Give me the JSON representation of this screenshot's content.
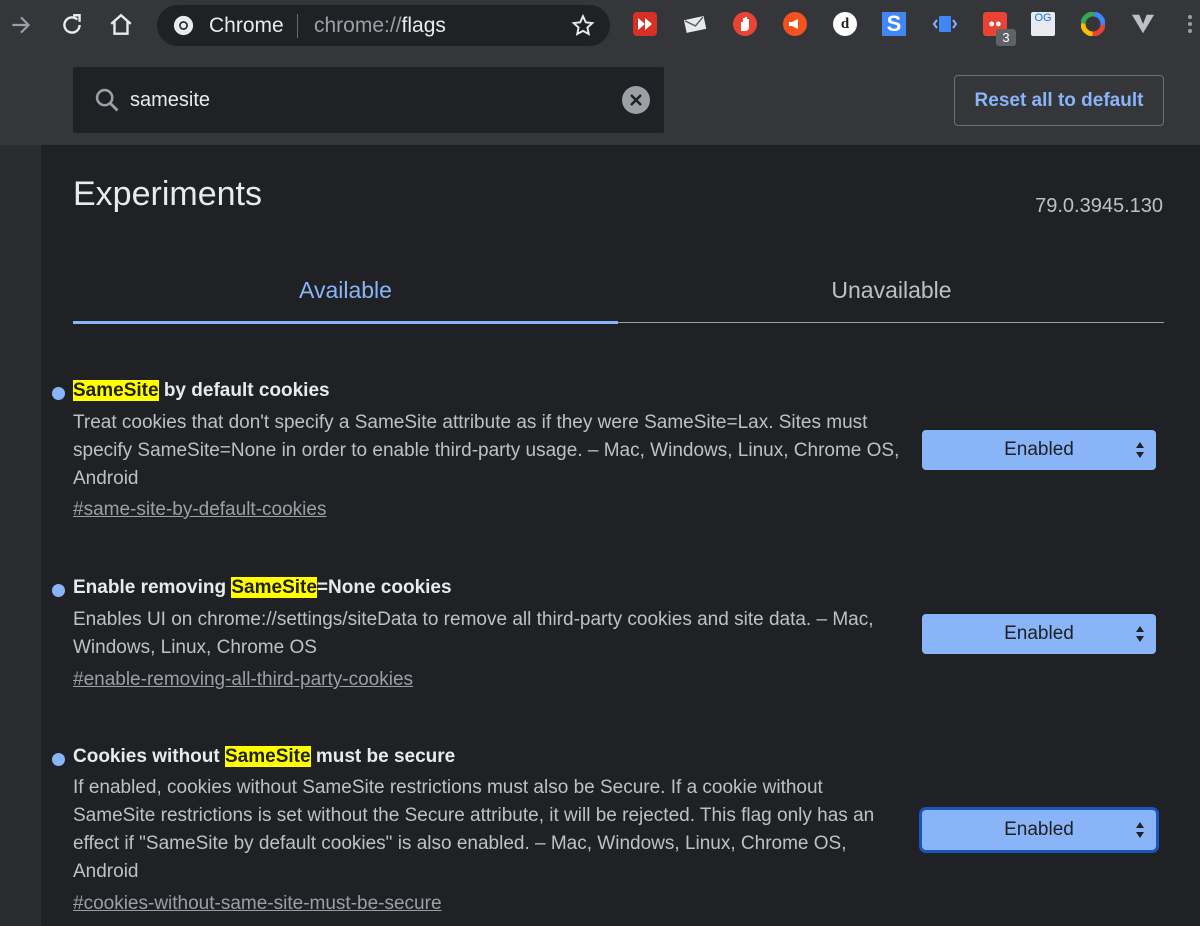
{
  "browser": {
    "site_label": "Chrome",
    "url_scheme": "chrome://",
    "url_path": "flags",
    "extension_badge": "3",
    "extension_og_label": "OG",
    "extension_d_label": "d"
  },
  "search": {
    "value": "samesite"
  },
  "header": {
    "reset_label": "Reset all to default"
  },
  "page": {
    "title": "Experiments",
    "version": "79.0.3945.130"
  },
  "tabs": [
    {
      "label": "Available",
      "active": true
    },
    {
      "label": "Unavailable",
      "active": false
    }
  ],
  "experiments": [
    {
      "title_before": "",
      "title_highlight": "SameSite",
      "title_after": " by default cookies",
      "description": "Treat cookies that don't specify a SameSite attribute as if they were SameSite=Lax. Sites must specify SameSite=None in order to enable third-party usage. – Mac, Windows, Linux, Chrome OS, Android",
      "link": "#same-site-by-default-cookies",
      "value": "Enabled"
    },
    {
      "title_before": "Enable removing ",
      "title_highlight": "SameSite",
      "title_after": "=None cookies",
      "description": "Enables UI on chrome://settings/siteData to remove all third-party cookies and site data. – Mac, Windows, Linux, Chrome OS",
      "link": "#enable-removing-all-third-party-cookies",
      "value": "Enabled"
    },
    {
      "title_before": "Cookies without ",
      "title_highlight": "SameSite",
      "title_after": " must be secure",
      "description": "If enabled, cookies without SameSite restrictions must also be Secure. If a cookie without SameSite restrictions is set without the Secure attribute, it will be rejected. This flag only has an effect if \"SameSite by default cookies\" is also enabled. – Mac, Windows, Linux, Chrome OS, Android",
      "link": "#cookies-without-same-site-must-be-secure",
      "value": "Enabled"
    }
  ],
  "colors": {
    "accent": "#8ab4f8",
    "highlight": "#ffff00",
    "background": "#202124",
    "toolbar": "#35363a"
  }
}
